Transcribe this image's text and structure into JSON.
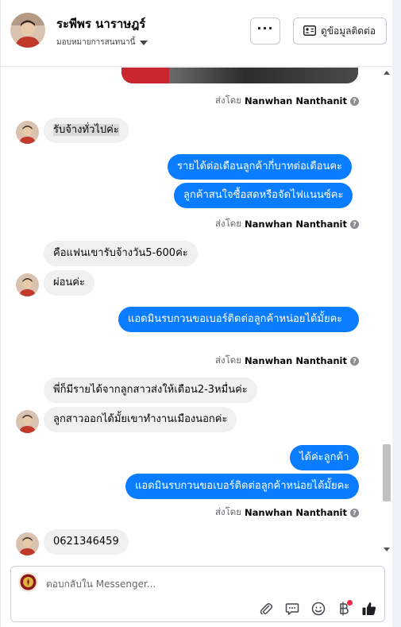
{
  "header": {
    "contact_name": "ระพีพร นาราษฎร์",
    "assign_label": "มอบหมายการสนทนานี้",
    "more_label": "···",
    "contact_info_label": "ดูข้อมูลติดต่อ"
  },
  "messages": [
    {
      "type": "sent_by",
      "prefix": "ส่งโดย",
      "name": "Nanwhan Nanthanit"
    },
    {
      "type": "in",
      "text": "รับจ้างทั่วไปค่ะ"
    },
    {
      "type": "out",
      "text": "รายได้ต่อเดือนลูกค้ากี่บาทต่อเดือนคะ"
    },
    {
      "type": "out",
      "text": "ลูกค้าสนใจซื้อสดหรือจัดไฟแนนซ์คะ"
    },
    {
      "type": "sent_by",
      "prefix": "ส่งโดย",
      "name": "Nanwhan Nanthanit"
    },
    {
      "type": "in",
      "text": "คือแฟนเขารับจ้างวัน5-600ค่ะ"
    },
    {
      "type": "in",
      "text": "ผ่อนค่ะ"
    },
    {
      "type": "out",
      "text": "แอดมินรบกวนขอเบอร์ติดต่อลูกค้าหน่อยได้มั้ยคะ"
    },
    {
      "type": "sent_by",
      "prefix": "ส่งโดย",
      "name": "Nanwhan Nanthanit"
    },
    {
      "type": "in",
      "text": "พี่ก็มีรายได้จากลูกสาวส่งให้เดือน2-3หมื่นค่ะ"
    },
    {
      "type": "in",
      "text": "ลูกสาวออกได้มั้ยเขาทำงานเมืองนอกค่ะ"
    },
    {
      "type": "out",
      "text": "ได้ค่ะลูกค้า"
    },
    {
      "type": "out",
      "text": "แอดมินรบกวนขอเบอร์ติดต่อลูกค้าหน่อยได้มั้ยคะ"
    },
    {
      "type": "sent_by",
      "prefix": "ส่งโดย",
      "name": "Nanwhan Nanthanit"
    },
    {
      "type": "in",
      "text": "0621346459"
    }
  ],
  "composer": {
    "placeholder": "ตอบกลับใน Messenger..."
  },
  "icons": {
    "attach": "paperclip-icon",
    "saved_replies": "speech-bubble-icon",
    "emoji": "smiley-icon",
    "payment": "baht-icon",
    "like": "thumbs-up-icon"
  },
  "colors": {
    "outgoing_bubble": "#0a7cff",
    "incoming_bubble": "#f0f0f0",
    "notification_dot": "#f02849"
  }
}
